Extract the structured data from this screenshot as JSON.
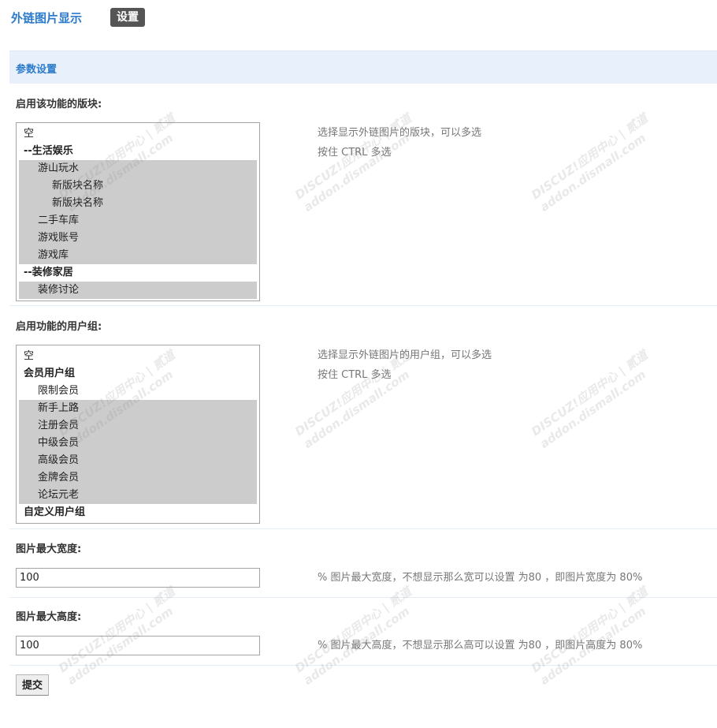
{
  "header": {
    "title": "外链图片显示",
    "tab_settings": "设置"
  },
  "section": {
    "title": "参数设置"
  },
  "forums": {
    "label": "启用该功能的版块:",
    "description_line1": "选择显示外链图片的版块，可以多选",
    "description_line2": "按住 CTRL 多选",
    "options": [
      {
        "label": "空",
        "indent": 0,
        "group": false,
        "selected": false
      },
      {
        "label": "--生活娱乐",
        "indent": 0,
        "group": true,
        "selected": false
      },
      {
        "label": "游山玩水",
        "indent": 1,
        "group": false,
        "selected": true
      },
      {
        "label": "新版块名称",
        "indent": 2,
        "group": false,
        "selected": true
      },
      {
        "label": "新版块名称",
        "indent": 2,
        "group": false,
        "selected": true
      },
      {
        "label": "二手车库",
        "indent": 1,
        "group": false,
        "selected": true
      },
      {
        "label": "游戏账号",
        "indent": 1,
        "group": false,
        "selected": true
      },
      {
        "label": "游戏库",
        "indent": 1,
        "group": false,
        "selected": true
      },
      {
        "label": "--装修家居",
        "indent": 0,
        "group": true,
        "selected": false
      },
      {
        "label": "装修讨论",
        "indent": 1,
        "group": false,
        "selected": true
      }
    ]
  },
  "usergroups": {
    "label": "启用功能的用户组:",
    "description_line1": "选择显示外链图片的用户组，可以多选",
    "description_line2": "按住 CTRL 多选",
    "options": [
      {
        "label": "空",
        "indent": 0,
        "group": false,
        "selected": false
      },
      {
        "label": "会员用户组",
        "indent": 0,
        "group": true,
        "selected": false
      },
      {
        "label": "限制会员",
        "indent": 1,
        "group": false,
        "selected": false
      },
      {
        "label": "新手上路",
        "indent": 1,
        "group": false,
        "selected": true
      },
      {
        "label": "注册会员",
        "indent": 1,
        "group": false,
        "selected": true
      },
      {
        "label": "中级会员",
        "indent": 1,
        "group": false,
        "selected": true
      },
      {
        "label": "高级会员",
        "indent": 1,
        "group": false,
        "selected": true
      },
      {
        "label": "金牌会员",
        "indent": 1,
        "group": false,
        "selected": true
      },
      {
        "label": "论坛元老",
        "indent": 1,
        "group": false,
        "selected": true
      },
      {
        "label": "自定义用户组",
        "indent": 0,
        "group": true,
        "selected": false
      }
    ]
  },
  "max_width": {
    "label": "图片最大宽度:",
    "value": "100",
    "description": "% 图片最大宽度，不想显示那么宽可以设置 为80 ，即图片宽度为 80%"
  },
  "max_height": {
    "label": "图片最大高度:",
    "value": "100",
    "description": "% 图片最大高度，不想显示那么高可以设置 为80 ，即图片高度为 80%"
  },
  "submit_label": "提交",
  "watermark": {
    "brand": "DISCUZ!应用中心 | 贰道",
    "url": "addon.dismall.com"
  },
  "colors": {
    "accent": "#2b7acb",
    "header_bg": "#e8f1fb",
    "selected_bg": "#cccccc"
  }
}
